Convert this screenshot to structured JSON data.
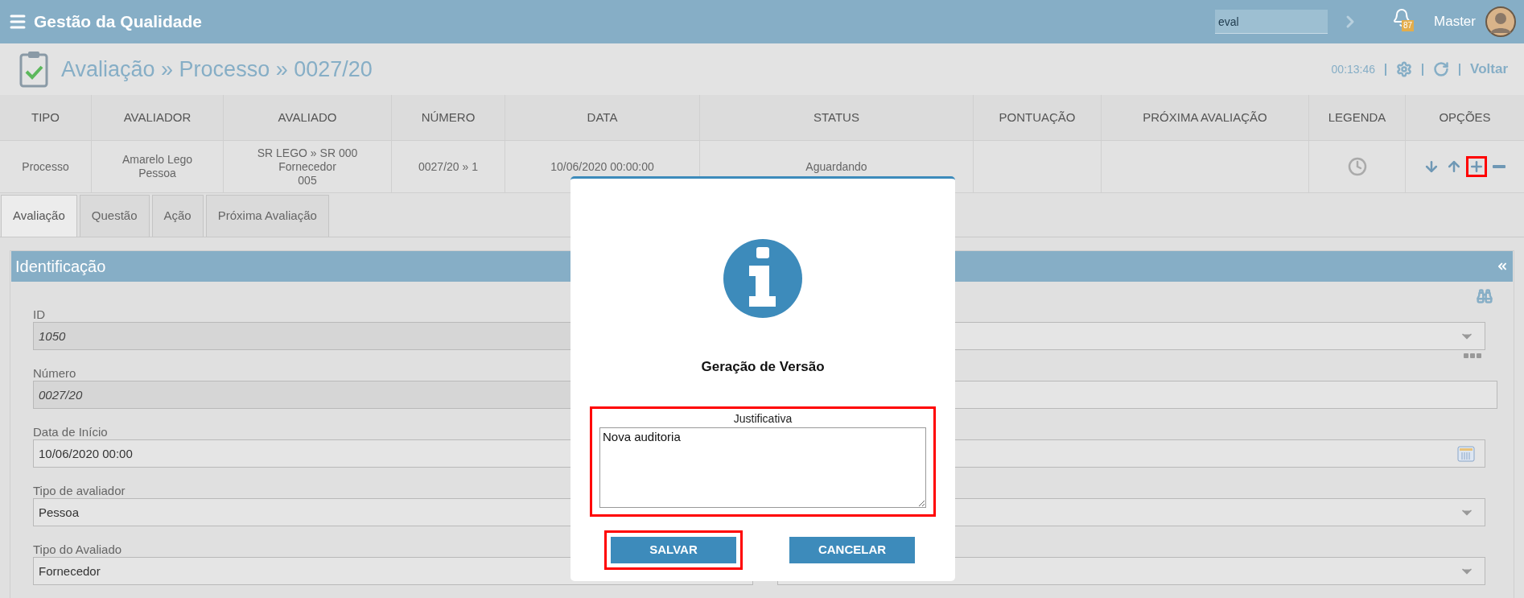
{
  "app": {
    "title": "Gestão da Qualidade",
    "search": {
      "value": "eval"
    },
    "notifications": {
      "count": "87"
    },
    "user": {
      "name": "Master"
    }
  },
  "header": {
    "breadcrumb": "Avaliação » Processo » 0027/20",
    "timer": "00:13:46",
    "back": "Voltar"
  },
  "table": {
    "columns": [
      "TIPO",
      "AVALIADOR",
      "AVALIADO",
      "NÚMERO",
      "DATA",
      "STATUS",
      "PONTUAÇÃO",
      "PRÓXIMA AVALIAÇÃO",
      "LEGENDA",
      "OPÇÕES"
    ],
    "rows": [
      {
        "cells": [
          [
            "Processo"
          ],
          [
            "Amarelo Lego",
            "Pessoa"
          ],
          [
            "SR LEGO » SR 000",
            "Fornecedor",
            "005"
          ],
          [
            "0027/20 » 1"
          ],
          [
            "10/06/2020 00:00:00"
          ],
          [
            "Aguardando"
          ],
          [],
          []
        ],
        "options": [
          {
            "kind": "down",
            "highlighted": false
          },
          {
            "kind": "up",
            "highlighted": false
          },
          {
            "kind": "add",
            "highlighted": true
          },
          {
            "kind": "remove",
            "highlighted": false
          }
        ]
      }
    ]
  },
  "tabs": [
    {
      "label": "Avaliação",
      "selected": true
    },
    {
      "label": "Questão",
      "selected": false
    },
    {
      "label": "Ação",
      "selected": false
    },
    {
      "label": "Próxima Avaliação",
      "selected": false
    }
  ],
  "panel": {
    "title": "Identificação",
    "fields_left": [
      {
        "label": "ID",
        "value": "1050",
        "kind": "readonly"
      },
      {
        "label": "Número",
        "value": "0027/20",
        "kind": "readonly"
      },
      {
        "label": "Data de Início",
        "value": "10/06/2020 00:00",
        "kind": "text"
      },
      {
        "label": "Tipo de avaliador",
        "value": "Pessoa",
        "kind": "text"
      },
      {
        "label": "Tipo do Avaliado",
        "value": "Fornecedor",
        "kind": "text"
      }
    ],
    "fields_right": [
      {
        "kind": "select"
      },
      {
        "kind": "text"
      },
      {
        "kind": "date"
      },
      {
        "kind": "select"
      },
      {
        "kind": "select"
      }
    ]
  },
  "dialog": {
    "title": "Geração de Versão",
    "field": {
      "label": "Justificativa",
      "value": "Nova auditoria",
      "highlighted": true
    },
    "buttons": [
      {
        "label": "SALVAR",
        "highlighted": true
      },
      {
        "label": "CANCELAR",
        "highlighted": false
      }
    ]
  }
}
